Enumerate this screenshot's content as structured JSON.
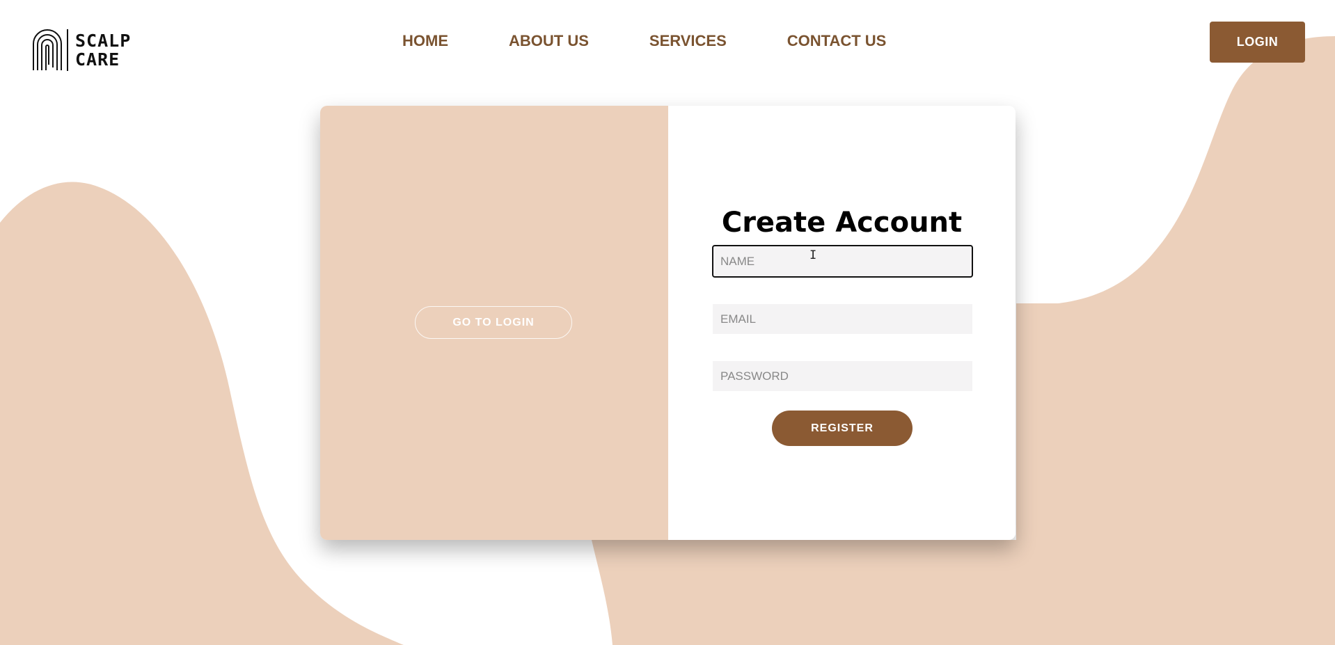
{
  "brand": {
    "name_line1": "SCALP",
    "name_line2": "CARE",
    "logo_icon": "fingerprint-arch-icon"
  },
  "nav": {
    "items": [
      {
        "label": "HOME"
      },
      {
        "label": "ABOUT US"
      },
      {
        "label": "SERVICES"
      },
      {
        "label": "CONTACT US"
      }
    ],
    "login_label": "LOGIN"
  },
  "card": {
    "left": {
      "goto_login_label": "GO TO LOGIN"
    },
    "right": {
      "title": "Create Account",
      "fields": {
        "name": {
          "placeholder": "NAME",
          "value": ""
        },
        "email": {
          "placeholder": "EMAIL",
          "value": ""
        },
        "password": {
          "placeholder": "PASSWORD",
          "value": ""
        }
      },
      "register_label": "REGISTER"
    }
  },
  "colors": {
    "brand_brown": "#8b5a33",
    "nav_text": "#7a5330",
    "beige": "#ecd0bb",
    "input_bg": "#f4f3f4"
  }
}
